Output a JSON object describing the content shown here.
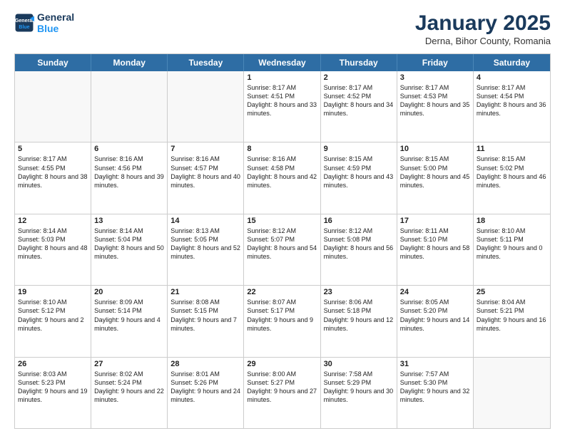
{
  "logo": {
    "line1": "General",
    "line2": "Blue"
  },
  "title": "January 2025",
  "subtitle": "Derna, Bihor County, Romania",
  "days": [
    "Sunday",
    "Monday",
    "Tuesday",
    "Wednesday",
    "Thursday",
    "Friday",
    "Saturday"
  ],
  "weeks": [
    [
      {
        "day": "",
        "empty": true
      },
      {
        "day": "",
        "empty": true
      },
      {
        "day": "",
        "empty": true
      },
      {
        "day": "1",
        "sunrise": "8:17 AM",
        "sunset": "4:51 PM",
        "daylight": "8 hours and 33 minutes."
      },
      {
        "day": "2",
        "sunrise": "8:17 AM",
        "sunset": "4:52 PM",
        "daylight": "8 hours and 34 minutes."
      },
      {
        "day": "3",
        "sunrise": "8:17 AM",
        "sunset": "4:53 PM",
        "daylight": "8 hours and 35 minutes."
      },
      {
        "day": "4",
        "sunrise": "8:17 AM",
        "sunset": "4:54 PM",
        "daylight": "8 hours and 36 minutes."
      }
    ],
    [
      {
        "day": "5",
        "sunrise": "8:17 AM",
        "sunset": "4:55 PM",
        "daylight": "8 hours and 38 minutes."
      },
      {
        "day": "6",
        "sunrise": "8:16 AM",
        "sunset": "4:56 PM",
        "daylight": "8 hours and 39 minutes."
      },
      {
        "day": "7",
        "sunrise": "8:16 AM",
        "sunset": "4:57 PM",
        "daylight": "8 hours and 40 minutes."
      },
      {
        "day": "8",
        "sunrise": "8:16 AM",
        "sunset": "4:58 PM",
        "daylight": "8 hours and 42 minutes."
      },
      {
        "day": "9",
        "sunrise": "8:15 AM",
        "sunset": "4:59 PM",
        "daylight": "8 hours and 43 minutes."
      },
      {
        "day": "10",
        "sunrise": "8:15 AM",
        "sunset": "5:00 PM",
        "daylight": "8 hours and 45 minutes."
      },
      {
        "day": "11",
        "sunrise": "8:15 AM",
        "sunset": "5:02 PM",
        "daylight": "8 hours and 46 minutes."
      }
    ],
    [
      {
        "day": "12",
        "sunrise": "8:14 AM",
        "sunset": "5:03 PM",
        "daylight": "8 hours and 48 minutes."
      },
      {
        "day": "13",
        "sunrise": "8:14 AM",
        "sunset": "5:04 PM",
        "daylight": "8 hours and 50 minutes."
      },
      {
        "day": "14",
        "sunrise": "8:13 AM",
        "sunset": "5:05 PM",
        "daylight": "8 hours and 52 minutes."
      },
      {
        "day": "15",
        "sunrise": "8:12 AM",
        "sunset": "5:07 PM",
        "daylight": "8 hours and 54 minutes."
      },
      {
        "day": "16",
        "sunrise": "8:12 AM",
        "sunset": "5:08 PM",
        "daylight": "8 hours and 56 minutes."
      },
      {
        "day": "17",
        "sunrise": "8:11 AM",
        "sunset": "5:10 PM",
        "daylight": "8 hours and 58 minutes."
      },
      {
        "day": "18",
        "sunrise": "8:10 AM",
        "sunset": "5:11 PM",
        "daylight": "9 hours and 0 minutes."
      }
    ],
    [
      {
        "day": "19",
        "sunrise": "8:10 AM",
        "sunset": "5:12 PM",
        "daylight": "9 hours and 2 minutes."
      },
      {
        "day": "20",
        "sunrise": "8:09 AM",
        "sunset": "5:14 PM",
        "daylight": "9 hours and 4 minutes."
      },
      {
        "day": "21",
        "sunrise": "8:08 AM",
        "sunset": "5:15 PM",
        "daylight": "9 hours and 7 minutes."
      },
      {
        "day": "22",
        "sunrise": "8:07 AM",
        "sunset": "5:17 PM",
        "daylight": "9 hours and 9 minutes."
      },
      {
        "day": "23",
        "sunrise": "8:06 AM",
        "sunset": "5:18 PM",
        "daylight": "9 hours and 12 minutes."
      },
      {
        "day": "24",
        "sunrise": "8:05 AM",
        "sunset": "5:20 PM",
        "daylight": "9 hours and 14 minutes."
      },
      {
        "day": "25",
        "sunrise": "8:04 AM",
        "sunset": "5:21 PM",
        "daylight": "9 hours and 16 minutes."
      }
    ],
    [
      {
        "day": "26",
        "sunrise": "8:03 AM",
        "sunset": "5:23 PM",
        "daylight": "9 hours and 19 minutes."
      },
      {
        "day": "27",
        "sunrise": "8:02 AM",
        "sunset": "5:24 PM",
        "daylight": "9 hours and 22 minutes."
      },
      {
        "day": "28",
        "sunrise": "8:01 AM",
        "sunset": "5:26 PM",
        "daylight": "9 hours and 24 minutes."
      },
      {
        "day": "29",
        "sunrise": "8:00 AM",
        "sunset": "5:27 PM",
        "daylight": "9 hours and 27 minutes."
      },
      {
        "day": "30",
        "sunrise": "7:58 AM",
        "sunset": "5:29 PM",
        "daylight": "9 hours and 30 minutes."
      },
      {
        "day": "31",
        "sunrise": "7:57 AM",
        "sunset": "5:30 PM",
        "daylight": "9 hours and 32 minutes."
      },
      {
        "day": "",
        "empty": true
      }
    ]
  ]
}
